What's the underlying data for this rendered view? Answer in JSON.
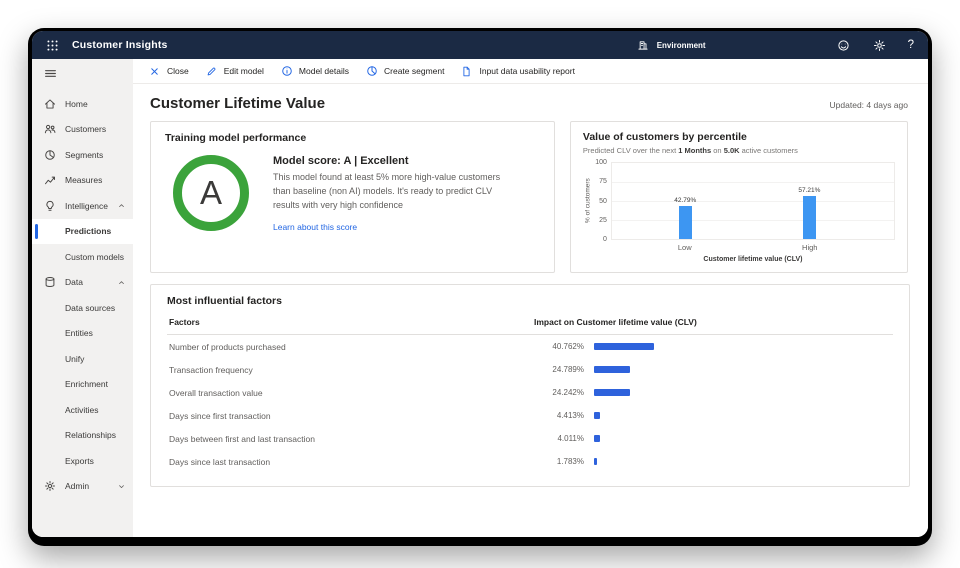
{
  "topbar": {
    "app_title": "Customer Insights",
    "environment_label": "Environment",
    "help_label": "?"
  },
  "toolbar": {
    "items": [
      {
        "label": "Close",
        "icon": "close-icon"
      },
      {
        "label": "Edit model",
        "icon": "edit-icon"
      },
      {
        "label": "Model details",
        "icon": "info-icon"
      },
      {
        "label": "Create segment",
        "icon": "segment-icon"
      },
      {
        "label": "Input data usability report",
        "icon": "report-icon"
      }
    ]
  },
  "sidebar": {
    "items": [
      {
        "label": "Home"
      },
      {
        "label": "Customers"
      },
      {
        "label": "Segments"
      },
      {
        "label": "Measures"
      },
      {
        "label": "Intelligence",
        "expanded": true
      },
      {
        "label": "Predictions",
        "selected": true
      },
      {
        "label": "Custom models"
      },
      {
        "label": "Data",
        "expanded": true
      },
      {
        "label": "Data sources"
      },
      {
        "label": "Entities"
      },
      {
        "label": "Unify"
      },
      {
        "label": "Enrichment"
      },
      {
        "label": "Activities"
      },
      {
        "label": "Relationships"
      },
      {
        "label": "Exports"
      },
      {
        "label": "Admin",
        "expanded": false
      }
    ]
  },
  "page": {
    "title": "Customer Lifetime Value",
    "updated": "Updated: 4 days ago"
  },
  "training_card": {
    "title": "Training model performance",
    "grade": "A",
    "score_title": "Model score: A | Excellent",
    "description": "This model found at least 5% more high-value customers than baseline (non AI) models. It's ready to predict CLV results with very high confidence",
    "link": "Learn about this score"
  },
  "percentile_card": {
    "title": "Value of customers by percentile",
    "subtitle_parts": {
      "p1": "Predicted CLV over the next ",
      "b1": "1 Months",
      "p2": " on ",
      "b2": "5.0K",
      "p3": " active customers"
    }
  },
  "factors_card": {
    "title": "Most influential factors",
    "col_factors": "Factors",
    "col_impact": "Impact on Customer lifetime value (CLV)"
  },
  "chart_data": [
    {
      "type": "bar",
      "title": "Value of customers by percentile",
      "subtitle": "Predicted CLV over the next 1 Months on 5.0K active customers",
      "categories": [
        "Low",
        "High"
      ],
      "values": [
        42.79,
        57.21
      ],
      "value_labels": [
        "42.79%",
        "57.21%"
      ],
      "xlabel": "Customer lifetime value (CLV)",
      "ylabel": "% of customers",
      "ylim": [
        0,
        100
      ],
      "yticks": [
        0,
        25,
        50,
        75,
        100
      ],
      "grid": true,
      "bar_color": "#3D96F2"
    },
    {
      "type": "bar",
      "orientation": "horizontal",
      "title": "Most influential factors",
      "categories": [
        "Number of products purchased",
        "Transaction frequency",
        "Overall transaction value",
        "Days since first transaction",
        "Days between first and last transaction",
        "Days since last transaction"
      ],
      "values": [
        40.762,
        24.789,
        24.242,
        4.413,
        4.011,
        1.783
      ],
      "value_labels": [
        "40.762%",
        "24.789%",
        "24.242%",
        "4.413%",
        "4.011%",
        "1.783%"
      ],
      "xlabel": "Impact on Customer lifetime value (CLV)",
      "bar_color": "#2E62DC"
    }
  ],
  "colors": {
    "topbar_bg": "#1B2A44",
    "accent_blue": "#2266E3",
    "ring_green": "#3BA33B",
    "chart_bar_blue": "#3D96F2",
    "factor_bar_blue": "#2E62DC"
  }
}
